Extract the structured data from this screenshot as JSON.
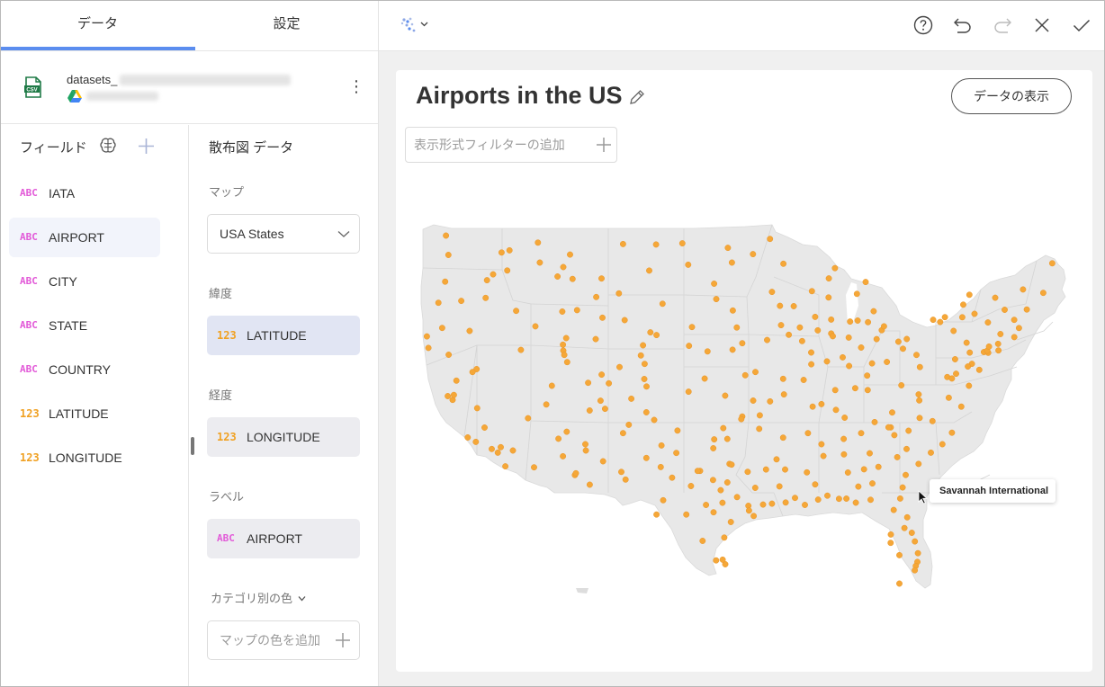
{
  "tabs": [
    {
      "label": "データ",
      "active": true
    },
    {
      "label": "設定",
      "active": false
    }
  ],
  "datasource": {
    "name_prefix": "datasets_",
    "file_type": "CSV",
    "icon": "csv-file-icon",
    "source_icon": "google-drive-icon"
  },
  "fields_panel": {
    "title": "フィールド",
    "items": [
      {
        "type": "ABC",
        "name": "IATA"
      },
      {
        "type": "ABC",
        "name": "AIRPORT"
      },
      {
        "type": "ABC",
        "name": "CITY"
      },
      {
        "type": "ABC",
        "name": "STATE"
      },
      {
        "type": "ABC",
        "name": "COUNTRY"
      },
      {
        "type": "123",
        "name": "LATITUDE"
      },
      {
        "type": "123",
        "name": "LONGITUDE"
      }
    ]
  },
  "config": {
    "title": "散布図 データ",
    "map_label": "マップ",
    "map_value": "USA States",
    "latitude_label": "緯度",
    "latitude_field": {
      "type": "123",
      "name": "LATITUDE"
    },
    "longitude_label": "経度",
    "longitude_field": {
      "type": "123",
      "name": "LONGITUDE"
    },
    "label_label": "ラベル",
    "label_field": {
      "type": "ABC",
      "name": "AIRPORT"
    },
    "category_color_label": "カテゴリ別の色",
    "add_map_color_placeholder": "マップの色を追加"
  },
  "visualization": {
    "title": "Airports in the US",
    "show_data_button": "データの表示",
    "filter_placeholder": "表示形式フィルターの追加",
    "tooltip": "Savannah International",
    "point_color": "#f5a738",
    "map_fill": "#e8e8e8"
  },
  "colors": {
    "accent": "#5b8def",
    "abc_type": "#e25ad8",
    "number_type": "#f0a123"
  },
  "airports": [
    [
      48.8,
      -122.53
    ],
    [
      47.45,
      -122.31
    ],
    [
      47.62,
      -117.53
    ],
    [
      46.1,
      -118.29
    ],
    [
      45.59,
      -122.6
    ],
    [
      44.12,
      -123.21
    ],
    [
      42.37,
      -122.87
    ],
    [
      40.98,
      -124.11
    ],
    [
      40.5,
      -122.29
    ],
    [
      39.5,
      -119.77
    ],
    [
      38.7,
      -121.59
    ],
    [
      37.62,
      -122.37
    ],
    [
      37.36,
      -121.93
    ],
    [
      36.78,
      -119.72
    ],
    [
      35.43,
      -119.06
    ],
    [
      34.43,
      -119.84
    ],
    [
      33.94,
      -118.41
    ],
    [
      33.68,
      -117.87
    ],
    [
      32.73,
      -117.19
    ],
    [
      33.83,
      -116.51
    ],
    [
      34.06,
      -117.6
    ],
    [
      36.08,
      -115.15
    ],
    [
      39.3,
      -120.14
    ],
    [
      37.7,
      -121.82
    ],
    [
      41.78,
      -124.24
    ],
    [
      34.74,
      -120.57
    ],
    [
      33.43,
      -112.01
    ],
    [
      32.12,
      -110.94
    ],
    [
      35.14,
      -111.67
    ],
    [
      34.65,
      -112.42
    ],
    [
      32.66,
      -114.61
    ],
    [
      35.04,
      -106.61
    ],
    [
      32.34,
      -106.76
    ],
    [
      36.74,
      -108.23
    ],
    [
      35.62,
      -106.09
    ],
    [
      31.81,
      -106.38
    ],
    [
      31.94,
      -102.2
    ],
    [
      33.66,
      -101.82
    ],
    [
      35.22,
      -101.71
    ],
    [
      31.36,
      -100.5
    ],
    [
      32.41,
      -99.68
    ],
    [
      32.9,
      -97.04
    ],
    [
      32.85,
      -96.85
    ],
    [
      29.98,
      -95.34
    ],
    [
      29.65,
      -95.28
    ],
    [
      29.53,
      -98.47
    ],
    [
      30.19,
      -97.67
    ],
    [
      27.77,
      -97.51
    ],
    [
      25.91,
      -97.42
    ],
    [
      26.23,
      -97.65
    ],
    [
      26.18,
      -98.24
    ],
    [
      27.54,
      -99.46
    ],
    [
      31.61,
      -97.23
    ],
    [
      33.99,
      -98.49
    ],
    [
      31.07,
      -97.83
    ],
    [
      29.27,
      -94.86
    ],
    [
      30.59,
      -96.36
    ],
    [
      32.35,
      -95.4
    ],
    [
      30.07,
      -94.02
    ],
    [
      31.23,
      -94.72
    ],
    [
      35.39,
      -97.6
    ],
    [
      36.2,
      -95.89
    ],
    [
      37.65,
      -97.43
    ],
    [
      39.07,
      -95.62
    ],
    [
      38.84,
      -99.27
    ],
    [
      37.93,
      -100.72
    ],
    [
      39.3,
      -94.71
    ],
    [
      38.75,
      -90.37
    ],
    [
      37.25,
      -93.39
    ],
    [
      38.82,
      -92.22
    ],
    [
      41.3,
      -95.89
    ],
    [
      40.85,
      -96.76
    ],
    [
      40.73,
      -99.01
    ],
    [
      41.12,
      -100.68
    ],
    [
      41.87,
      -103.6
    ],
    [
      41.53,
      -93.66
    ],
    [
      42.4,
      -96.38
    ],
    [
      41.89,
      -91.71
    ],
    [
      42.4,
      -90.71
    ],
    [
      42.56,
      -92.4
    ],
    [
      43.58,
      -96.74
    ],
    [
      44.05,
      -103.06
    ],
    [
      44.38,
      -98.23
    ],
    [
      45.45,
      -98.42
    ],
    [
      46.92,
      -96.82
    ],
    [
      46.77,
      -100.75
    ],
    [
      48.26,
      -101.28
    ],
    [
      48.18,
      -103.64
    ],
    [
      47.95,
      -97.18
    ],
    [
      44.88,
      -93.22
    ],
    [
      46.84,
      -92.19
    ],
    [
      43.91,
      -92.5
    ],
    [
      47.51,
      -94.93
    ],
    [
      48.57,
      -93.4
    ],
    [
      44.93,
      -89.63
    ],
    [
      44.49,
      -88.13
    ],
    [
      43.14,
      -89.34
    ],
    [
      42.95,
      -87.9
    ],
    [
      43.88,
      -91.26
    ],
    [
      46.53,
      -87.56
    ],
    [
      45.82,
      -88.11
    ],
    [
      42.88,
      -85.52
    ],
    [
      42.21,
      -83.35
    ],
    [
      42.77,
      -84.59
    ],
    [
      43.53,
      -84.08
    ],
    [
      44.74,
      -85.58
    ],
    [
      45.57,
      -84.8
    ],
    [
      41.98,
      -87.9
    ],
    [
      41.79,
      -87.75
    ],
    [
      40.66,
      -89.69
    ],
    [
      40.04,
      -88.28
    ],
    [
      39.84,
      -89.68
    ],
    [
      42.2,
      -89.1
    ],
    [
      41.45,
      -90.51
    ],
    [
      39.72,
      -86.29
    ],
    [
      41.7,
      -86.32
    ],
    [
      41.0,
      -85.2
    ],
    [
      38.04,
      -87.53
    ],
    [
      39.05,
      -84.66
    ],
    [
      39.9,
      -84.22
    ],
    [
      40.0,
      -82.89
    ],
    [
      41.41,
      -81.85
    ],
    [
      41.59,
      -83.81
    ],
    [
      40.92,
      -81.44
    ],
    [
      38.17,
      -85.74
    ],
    [
      38.04,
      -84.61
    ],
    [
      37.06,
      -88.77
    ],
    [
      36.12,
      -86.68
    ],
    [
      35.04,
      -89.98
    ],
    [
      35.81,
      -83.99
    ],
    [
      35.04,
      -85.2
    ],
    [
      36.48,
      -82.41
    ],
    [
      34.27,
      -88.77
    ],
    [
      32.31,
      -90.08
    ],
    [
      30.41,
      -89.07
    ],
    [
      31.47,
      -89.34
    ],
    [
      33.45,
      -88.59
    ],
    [
      30.04,
      -90.26
    ],
    [
      30.53,
      -91.15
    ],
    [
      30.21,
      -91.99
    ],
    [
      32.51,
      -93.75
    ],
    [
      31.33,
      -92.55
    ],
    [
      30.13,
      -93.22
    ],
    [
      32.51,
      -92.04
    ],
    [
      34.73,
      -92.22
    ],
    [
      36.28,
      -94.31
    ],
    [
      35.34,
      -94.37
    ],
    [
      33.22,
      -92.81
    ],
    [
      33.56,
      -86.75
    ],
    [
      32.3,
      -86.39
    ],
    [
      30.69,
      -88.24
    ],
    [
      34.64,
      -86.77
    ],
    [
      31.32,
      -85.45
    ],
    [
      33.64,
      -84.43
    ],
    [
      32.52,
      -84.94
    ],
    [
      31.54,
      -84.19
    ],
    [
      32.69,
      -83.65
    ],
    [
      33.37,
      -81.96
    ],
    [
      32.13,
      -81.2
    ],
    [
      31.26,
      -81.47
    ],
    [
      30.49,
      -81.69
    ],
    [
      30.47,
      -87.19
    ],
    [
      30.48,
      -86.53
    ],
    [
      30.2,
      -85.68
    ],
    [
      30.4,
      -84.35
    ],
    [
      29.69,
      -82.27
    ],
    [
      28.43,
      -81.31
    ],
    [
      29.18,
      -81.06
    ],
    [
      28.1,
      -80.65
    ],
    [
      27.98,
      -82.53
    ],
    [
      27.4,
      -82.55
    ],
    [
      26.54,
      -81.76
    ],
    [
      26.68,
      -80.1
    ],
    [
      26.07,
      -80.15
    ],
    [
      25.79,
      -80.29
    ],
    [
      24.56,
      -81.76
    ],
    [
      25.49,
      -80.38
    ],
    [
      27.5,
      -80.37
    ],
    [
      32.9,
      -80.04
    ],
    [
      33.94,
      -81.12
    ],
    [
      34.9,
      -82.22
    ],
    [
      33.68,
      -78.93
    ],
    [
      35.21,
      -80.94
    ],
    [
      36.1,
      -79.94
    ],
    [
      35.88,
      -78.79
    ],
    [
      34.27,
      -77.9
    ],
    [
      35.07,
      -77.04
    ],
    [
      35.44,
      -82.54
    ],
    [
      37.32,
      -79.98
    ],
    [
      37.51,
      -77.32
    ],
    [
      36.89,
      -76.2
    ],
    [
      38.95,
      -77.46
    ],
    [
      38.85,
      -77.04
    ],
    [
      39.18,
      -76.67
    ],
    [
      38.37,
      -81.59
    ],
    [
      39.64,
      -79.92
    ],
    [
      40.49,
      -80.23
    ],
    [
      40.19,
      -76.76
    ],
    [
      40.65,
      -75.44
    ],
    [
      41.34,
      -75.72
    ],
    [
      39.87,
      -75.24
    ],
    [
      40.69,
      -74.17
    ],
    [
      40.64,
      -73.78
    ],
    [
      40.78,
      -73.87
    ],
    [
      42.75,
      -73.8
    ],
    [
      43.11,
      -76.11
    ],
    [
      43.12,
      -77.67
    ],
    [
      42.94,
      -78.73
    ],
    [
      42.16,
      -76.89
    ],
    [
      41.94,
      -72.68
    ],
    [
      41.73,
      -71.43
    ],
    [
      42.36,
      -71.01
    ],
    [
      42.93,
      -71.44
    ],
    [
      43.65,
      -70.31
    ],
    [
      44.81,
      -68.83
    ],
    [
      46.87,
      -68.02
    ],
    [
      44.47,
      -73.15
    ],
    [
      43.63,
      -72.3
    ],
    [
      41.26,
      -72.89
    ],
    [
      39.45,
      -74.58
    ],
    [
      38.34,
      -75.51
    ],
    [
      39.68,
      -75.61
    ],
    [
      41.07,
      -73.71
    ],
    [
      40.8,
      -72.86
    ],
    [
      39.86,
      -104.67
    ],
    [
      38.81,
      -104.7
    ],
    [
      38.29,
      -104.5
    ],
    [
      40.45,
      -105.01
    ],
    [
      37.44,
      -105.86
    ],
    [
      39.64,
      -106.92
    ],
    [
      39.12,
      -108.53
    ],
    [
      37.3,
      -108.63
    ],
    [
      38.51,
      -107.89
    ],
    [
      41.16,
      -104.81
    ],
    [
      42.91,
      -106.46
    ],
    [
      41.59,
      -109.07
    ],
    [
      43.61,
      -110.74
    ],
    [
      44.52,
      -109.02
    ],
    [
      44.77,
      -106.98
    ],
    [
      40.79,
      -111.98
    ],
    [
      41.2,
      -112.01
    ],
    [
      38.34,
      -113.01
    ],
    [
      37.04,
      -113.51
    ],
    [
      40.49,
      -111.89
    ],
    [
      43.56,
      -116.22
    ],
    [
      42.48,
      -114.49
    ],
    [
      43.51,
      -112.07
    ],
    [
      46.37,
      -117.02
    ],
    [
      47.77,
      -116.82
    ],
    [
      45.81,
      -108.54
    ],
    [
      46.92,
      -114.09
    ],
    [
      47.48,
      -111.37
    ],
    [
      45.78,
      -111.15
    ],
    [
      46.61,
      -111.98
    ],
    [
      48.31,
      -114.26
    ],
    [
      45.95,
      -112.5
    ],
    [
      48.21,
      -106.61
    ],
    [
      46.36,
      -104.25
    ],
    [
      42.06,
      -104.15
    ],
    [
      43.08,
      -108.46
    ],
    [
      44.46,
      -118.96
    ],
    [
      42.16,
      -120.4
    ],
    [
      44.25,
      -121.15
    ],
    [
      45.69,
      -118.84
    ],
    [
      40.84,
      -115.79
    ],
    [
      41.66,
      -111.72
    ],
    [
      39.99,
      -111.63
    ],
    [
      38.55,
      -109.75
    ],
    [
      42.43,
      -100.41
    ],
    [
      36.66,
      -87.47
    ],
    [
      37.74,
      -92.14
    ],
    [
      36.89,
      -89.56
    ],
    [
      35.45,
      -82.74
    ],
    [
      33.31,
      -104.51
    ],
    [
      36.02,
      -95.98
    ],
    [
      34.64,
      -97.23
    ],
    [
      34.61,
      -98.41
    ],
    [
      37.31,
      -94.91
    ],
    [
      40.32,
      -86.86
    ],
    [
      41.6,
      -81.1
    ],
    [
      42.78,
      -78.1
    ],
    [
      44.68,
      -75.47
    ],
    [
      43.99,
      -76.02
    ],
    [
      45.05,
      -70.65
    ],
    [
      43.35,
      -75.01
    ],
    [
      42.48,
      -83.15
    ],
    [
      42.81,
      -86.2
    ],
    [
      37.74,
      -80.03
    ],
    [
      32.41,
      -99.9
    ],
    [
      30.37,
      -103.0
    ],
    [
      29.37,
      -100.92
    ],
    [
      28.85,
      -96.92
    ],
    [
      34.18,
      -103.15
    ],
    [
      35.96,
      -103.81
    ],
    [
      33.08,
      -108.4
    ],
    [
      36.49,
      -104.51
    ],
    [
      32.68,
      -103.22
    ],
    [
      29.37,
      -103.6
    ],
    [
      31.78,
      -98.52
    ],
    [
      30.04,
      -99.15
    ],
    [
      32.25,
      -110.85
    ],
    [
      31.45,
      -109.6
    ],
    [
      33.83,
      -109.95
    ],
    [
      36.62,
      -109.61
    ],
    [
      34.27,
      -110.0
    ]
  ]
}
